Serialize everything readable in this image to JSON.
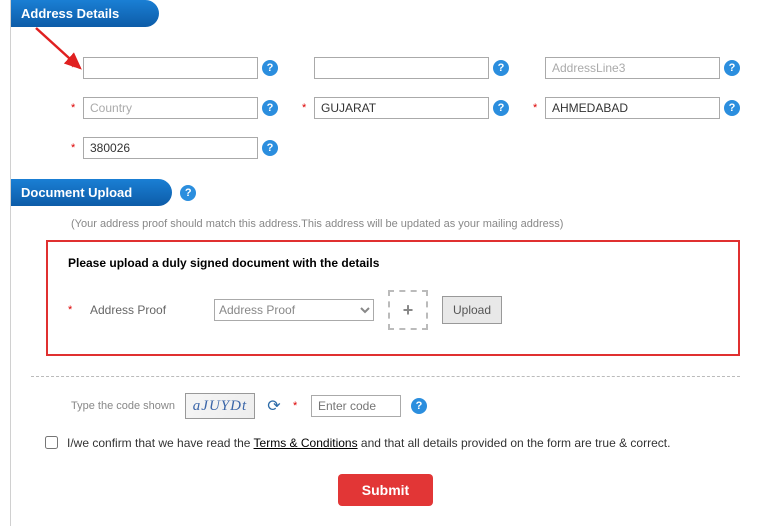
{
  "headers": {
    "address": "Address Details",
    "document": "Document Upload"
  },
  "address": {
    "line1": {
      "placeholder": "",
      "value": ""
    },
    "line2": {
      "placeholder": "",
      "value": ""
    },
    "line3": {
      "placeholder": "AddressLine3",
      "value": ""
    },
    "country": {
      "placeholder": "Country",
      "value": ""
    },
    "state": {
      "placeholder": "",
      "value": "GUJARAT"
    },
    "city": {
      "placeholder": "",
      "value": "AHMEDABAD"
    },
    "pin": {
      "placeholder": "",
      "value": "380026"
    }
  },
  "document": {
    "note": "(Your address proof should match this address.This address will be updated as your mailing address)",
    "title": "Please upload a duly signed document with the details",
    "proof_label": "Address Proof",
    "select_placeholder": "Address Proof",
    "upload_btn": "Upload"
  },
  "captcha": {
    "label": "Type the code shown",
    "image_text": "aJUYDt",
    "input_placeholder": "Enter code"
  },
  "confirm": {
    "pre": "I/we confirm that we have read the ",
    "link": "Terms & Conditions",
    "post": " and that all details provided on the form are true & correct."
  },
  "submit": "Submit",
  "req_mark": "*"
}
